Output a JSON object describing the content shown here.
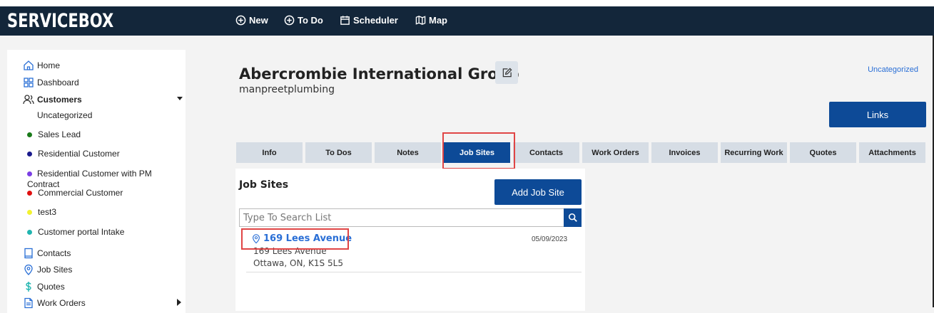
{
  "app": {
    "logo": "SERVICEBOX",
    "nav": [
      "New",
      "To Do",
      "Scheduler",
      "Map"
    ]
  },
  "sidebar": {
    "items": [
      {
        "label": "Home",
        "icon": "home-icon"
      },
      {
        "label": "Dashboard",
        "icon": "dashboard-icon"
      },
      {
        "label": "Customers",
        "icon": "customers-icon"
      },
      {
        "label": "Contacts",
        "icon": "contacts-icon"
      },
      {
        "label": "Job Sites",
        "icon": "location-pin-icon"
      },
      {
        "label": "Quotes",
        "icon": "dollar-icon"
      },
      {
        "label": "Work Orders",
        "icon": "document-icon"
      }
    ],
    "customer_categories": [
      {
        "label": "Uncategorized",
        "color": ""
      },
      {
        "label": "Sales Lead",
        "color": "#1a7a1a"
      },
      {
        "label": "Residential Customer",
        "color": "#1a1a8c"
      },
      {
        "label": "Residential Customer with PM Contract",
        "color": "#7b3fe4"
      },
      {
        "label": "Commercial Customer",
        "color": "#e01010"
      },
      {
        "label": "test3",
        "color": "#f2f230"
      },
      {
        "label": "Customer portal Intake",
        "color": "#21b5b0"
      }
    ]
  },
  "customer": {
    "name": "Abercrombie International Group",
    "account": "manpreetplumbing",
    "category_link": "Uncategorized",
    "links_label": "Links"
  },
  "tabs": [
    "Info",
    "To Dos",
    "Notes",
    "Job Sites",
    "Contacts",
    "Work Orders",
    "Invoices",
    "Recurring Work",
    "Quotes",
    "Attachments"
  ],
  "active_tab": "Job Sites",
  "jobsites": {
    "title": "Job Sites",
    "add_label": "Add Job Site",
    "search_placeholder": "Type To Search List",
    "items": [
      {
        "name": "169 Lees Avenue",
        "date": "05/09/2023",
        "address1": "169 Lees Avenue",
        "address2": "Ottawa, ON, K1S 5L5"
      }
    ]
  },
  "colors": {
    "navbar": "#13263a",
    "accent": "#0d4a97",
    "link": "#2a6fd6",
    "highlight": "#e04545"
  }
}
